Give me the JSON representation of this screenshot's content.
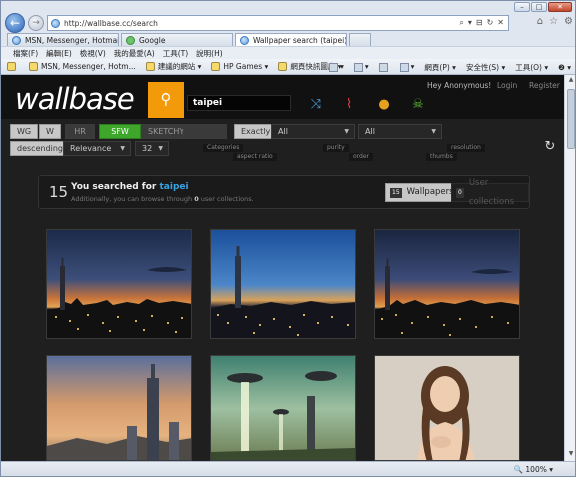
{
  "window": {
    "minimize": "–",
    "maximize": "□",
    "close": "✕"
  },
  "nav": {
    "url": "http://wallbase.cc/search",
    "back_icon": "←",
    "forward_icon": "→",
    "search_icon": "⌕",
    "dropdown_icon": "▾",
    "compat_icon": "⊟",
    "refresh_icon": "↻",
    "stop_icon": "✕",
    "home_icon": "⌂",
    "favorites_icon": "☆",
    "tools_icon": "⚙"
  },
  "tabs": [
    {
      "label": "MSN, Messenger, Hotmail - ..."
    },
    {
      "label": "Google"
    },
    {
      "label": "Wallpaper search (taipei) ...",
      "close": "×"
    }
  ],
  "menu": [
    "檔案(F)",
    "編輯(E)",
    "檢視(V)",
    "我的最愛(A)",
    "工具(T)",
    "說明(H)"
  ],
  "favbar": [
    "MSN, Messenger, Hotm...",
    "建議的網站 ▾",
    "HP Games ▾",
    "網頁快訊圖庫 ▾"
  ],
  "cmdbar": [
    "▾",
    "▾",
    "▾",
    "網頁(P) ▾",
    "安全性(S) ▾",
    "工具(O) ▾",
    "❷ ▾"
  ],
  "site": {
    "logo": "wallbase",
    "search_icon": "⚲",
    "query": "taipei",
    "icons": [
      "⤨",
      "⌇",
      "●",
      "☠"
    ],
    "greeting": "Hey Anonymous!",
    "login": "Login",
    "register": "Register",
    "refresh_icon": "↻"
  },
  "filters": {
    "wg": "WG",
    "w": "W",
    "hr": "HR",
    "sfw": "SFW",
    "sketchy": "SKETCHY",
    "match": "Exactly",
    "categories": "All",
    "purity": "All",
    "order": "descending",
    "sort": "Relevance",
    "per_page": "32",
    "arrow": "▼"
  },
  "tips": {
    "categories": "Categories",
    "aspect_ratio": "aspect ratio",
    "purity": "purity",
    "order": "order",
    "thumbs": "thumbs",
    "resolution": "resolution"
  },
  "results": {
    "count": "15",
    "prefix": "You searched for",
    "query": "taipei",
    "note_prefix": "Additionally, you can browse through",
    "collections_count": "0",
    "note_suffix": "user collections.",
    "wallpapers_badge": "15",
    "wallpapers_label": "Wallpapers",
    "collections_badge": "0",
    "collections_label": "User collections"
  },
  "scrollbar": {
    "up": "▲",
    "down": "▼"
  },
  "status": {
    "zoom": "🔍 100% ▾"
  },
  "colors": {
    "accent": "#f39a0a",
    "sfw_green": "#3da62b",
    "query_blue": "#38a2e3"
  }
}
